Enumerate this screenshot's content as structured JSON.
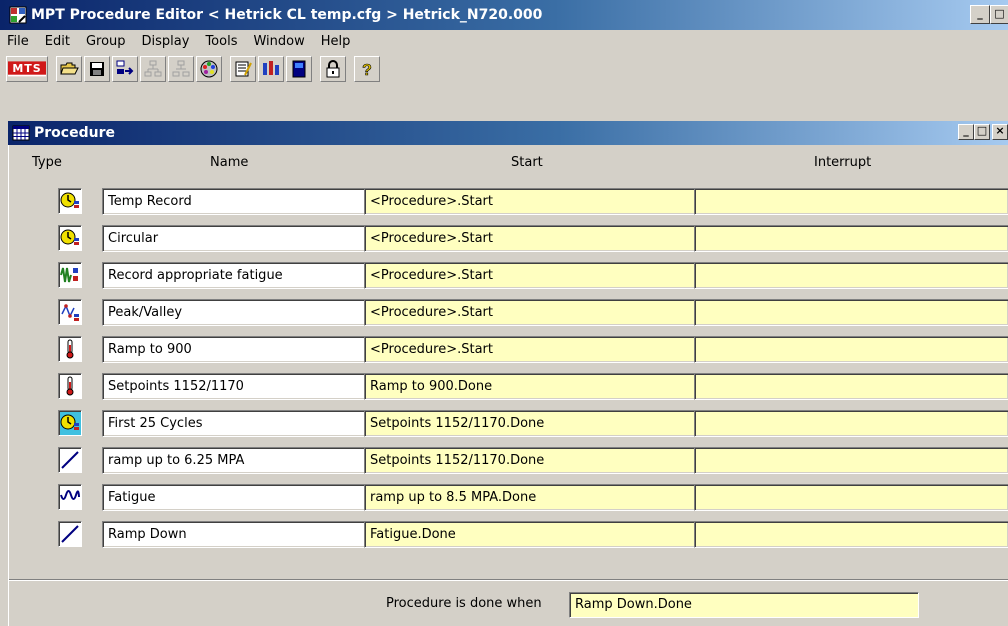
{
  "window": {
    "title": "MPT Procedure Editor  < Hetrick CL temp.cfg >  Hetrick_N720.000",
    "minimize_glyph": "_",
    "maximize_glyph": "□"
  },
  "menu": [
    "File",
    "Edit",
    "Group",
    "Display",
    "Tools",
    "Window",
    "Help"
  ],
  "toolbar": {
    "mts_label": "MTS",
    "buttons": [
      "open-folder-icon",
      "save-icon",
      "insert-icon",
      "group-icon-disabled",
      "ungroup-icon-disabled",
      "palette-icon",
      "edit-list-icon",
      "signal-icon",
      "book-icon",
      "lock-icon",
      "help-icon"
    ]
  },
  "procedure": {
    "title": "Procedure",
    "win_min": "_",
    "win_max": "□",
    "win_close": "×",
    "headers": {
      "type": "Type",
      "name": "Name",
      "start": "Start",
      "interrupt": "Interrupt"
    },
    "rows": [
      {
        "type_icon": "data-acquisition-icon",
        "name": "Temp Record",
        "start": "<Procedure>.Start",
        "interrupt": ""
      },
      {
        "type_icon": "data-acquisition-icon",
        "name": "Circular",
        "start": "<Procedure>.Start",
        "interrupt": ""
      },
      {
        "type_icon": "fatigue-record-icon",
        "name": "Record appropriate fatigue",
        "start": "<Procedure>.Start",
        "interrupt": ""
      },
      {
        "type_icon": "peak-valley-icon",
        "name": "Peak/Valley",
        "start": "<Procedure>.Start",
        "interrupt": ""
      },
      {
        "type_icon": "thermometer-icon",
        "name": "Ramp to 900",
        "start": "<Procedure>.Start",
        "interrupt": ""
      },
      {
        "type_icon": "thermometer-icon",
        "name": "Setpoints 1152/1170",
        "start": "Ramp to 900.Done",
        "interrupt": ""
      },
      {
        "type_icon": "data-acquisition-icon",
        "name": "First 25 Cycles",
        "start": "Setpoints 1152/1170.Done",
        "interrupt": ""
      },
      {
        "type_icon": "ramp-icon",
        "name": "ramp up to 6.25 MPA",
        "start": "Setpoints 1152/1170.Done",
        "interrupt": ""
      },
      {
        "type_icon": "cyclic-icon",
        "name": "Fatigue",
        "start": "ramp up to 8.5 MPA.Done",
        "interrupt": ""
      },
      {
        "type_icon": "ramp-icon",
        "name": "Ramp Down",
        "start": "Fatigue.Done",
        "interrupt": ""
      }
    ],
    "done_label": "Procedure is done when",
    "done_value": "Ramp Down.Done"
  },
  "colors": {
    "title_gradient_start": "#0a246a",
    "title_gradient_end": "#a6caf0",
    "field_yellow": "#ffffc0",
    "face": "#d4d0c8"
  }
}
